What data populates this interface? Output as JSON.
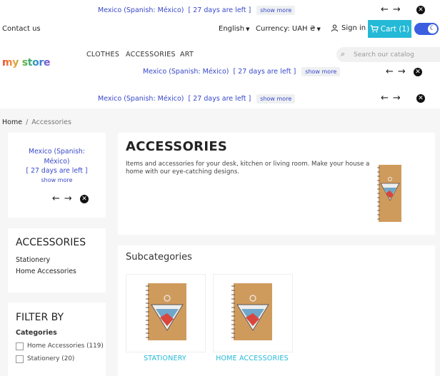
{
  "banner": {
    "name": "Mexico (Spanish: México)",
    "days_left": "[ 27 days are left ]",
    "show_more": "show more",
    "sidebar_name_1": "Mexico (Spanish:",
    "sidebar_name_2": "México)"
  },
  "header": {
    "contact": "Contact us",
    "language": "English",
    "currency": "Currency: UAH ₴",
    "sign_in": "Sign in",
    "cart": "Cart (1)"
  },
  "logo": {
    "text": "my store"
  },
  "nav": {
    "items": [
      "CLOTHES",
      "ACCESSORIES",
      "ART"
    ]
  },
  "search": {
    "placeholder": "Search our catalog"
  },
  "breadcrumb": [
    "Home",
    "Accessories"
  ],
  "category": {
    "title": "ACCESSORIES",
    "description": "Items and accessories for your desk, kitchen or living room. Make your house a home with our eye-catching designs."
  },
  "sidebar": {
    "title": "ACCESSORIES",
    "links": [
      "Stationery",
      "Home Accessories"
    ],
    "filter_title": "FILTER BY",
    "categories_label": "Categories",
    "filters": [
      "Home Accessories (119)",
      "Stationery (20)"
    ]
  },
  "subcategories": {
    "title": "Subcategories",
    "items": [
      "STATIONERY",
      "HOME ACCESSORIES"
    ]
  },
  "colors": {
    "accent": "#24b9d7",
    "link": "#3848c8",
    "toggle": "#3b5ee0"
  }
}
